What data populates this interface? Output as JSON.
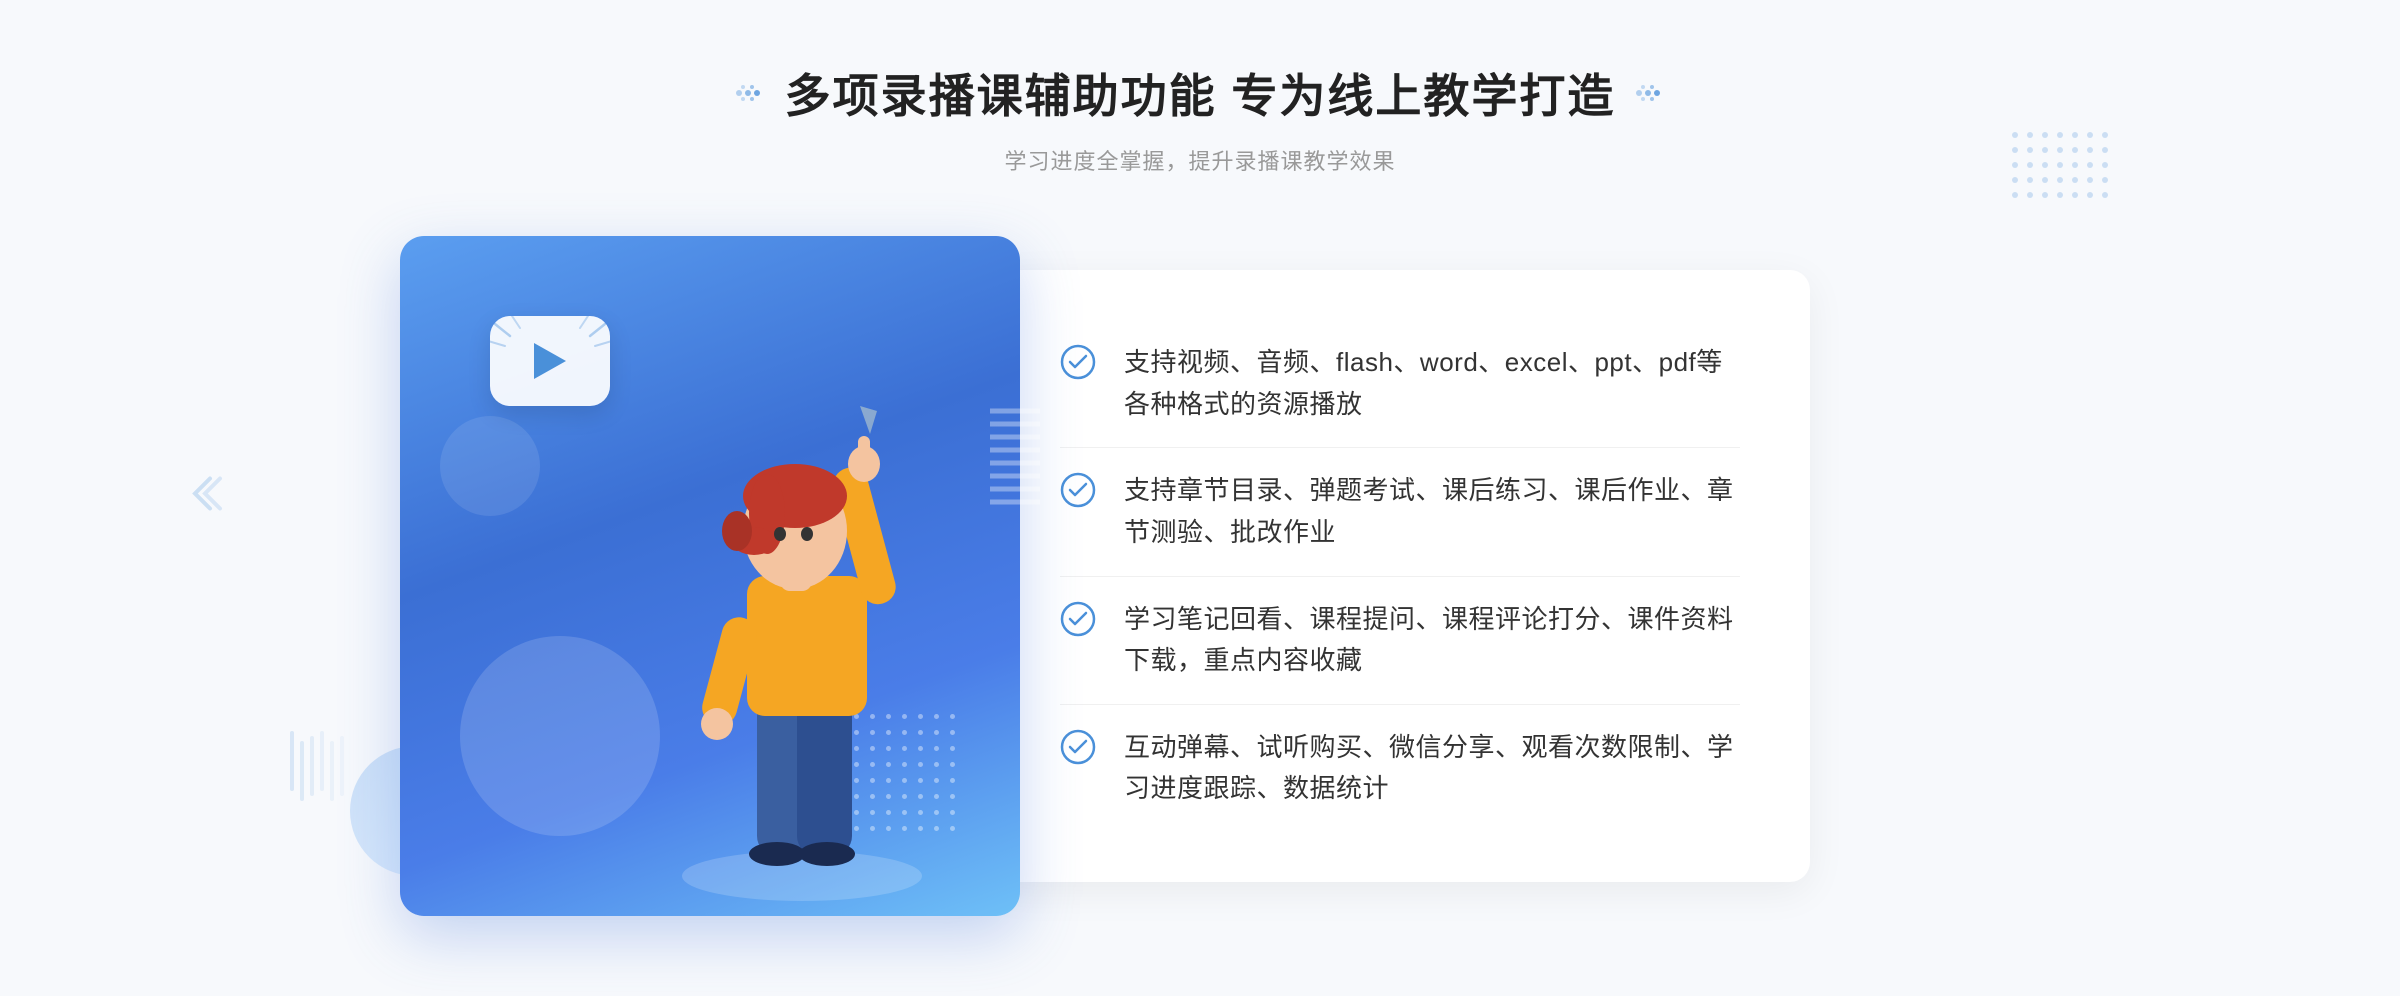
{
  "page": {
    "background_color": "#f7f9fc"
  },
  "header": {
    "title": "多项录播课辅助功能 专为线上教学打造",
    "subtitle": "学习进度全掌握，提升录播课教学效果"
  },
  "features": [
    {
      "id": 1,
      "text": "支持视频、音频、flash、word、excel、ppt、pdf等各种格式的资源播放"
    },
    {
      "id": 2,
      "text": "支持章节目录、弹题考试、课后练习、课后作业、章节测验、批改作业"
    },
    {
      "id": 3,
      "text": "学习笔记回看、课程提问、课程评论打分、课件资料下载，重点内容收藏"
    },
    {
      "id": 4,
      "text": "互动弹幕、试听购买、微信分享、观看次数限制、学习进度跟踪、数据统计"
    }
  ],
  "decorations": {
    "dots_color": "#4a90d9",
    "accent_blue": "#3b6fd4",
    "light_blue": "#e8f2ff"
  }
}
